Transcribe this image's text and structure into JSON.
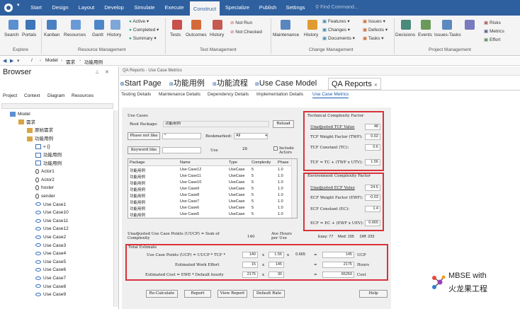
{
  "menubar": {
    "app_icon": "ea-icon",
    "tabs": [
      "Start",
      "Design",
      "Layout",
      "Develop",
      "Simulate",
      "Execute",
      "Construct",
      "Specialize",
      "Publish",
      "Settings"
    ],
    "active_tab": "Construct",
    "find_placeholder": "Find Command..."
  },
  "ribbon": {
    "explore": {
      "group": "Explore",
      "search": "Search",
      "portals": "Portals"
    },
    "resource": {
      "group": "Resource Management",
      "kanban": "Kanban",
      "resources": "Resources",
      "gantt": "Gantt",
      "history": "History",
      "active": "Active",
      "completed": "Completed",
      "summary": "Summary"
    },
    "test": {
      "group": "Test Management",
      "tests": "Tests",
      "outcomes": "Outcomes",
      "history": "History",
      "not_run": "Not Run",
      "not_checked": "Not Checked"
    },
    "change": {
      "group": "Change Management",
      "maintenance": "Maintenance",
      "history": "History",
      "features": "Features",
      "changes": "Changes",
      "documents": "Documents",
      "issues": "Issues",
      "defects": "Defects",
      "tasks": "Tasks"
    },
    "project": {
      "group": "Project Management",
      "decisions": "Decisions",
      "events": "Events",
      "issues_tasks": "Issues-Tasks",
      "risks": "Risks",
      "metrics": "Metrics",
      "effort": "Effort"
    }
  },
  "address": {
    "path": [
      "/",
      "Model",
      "需求",
      "功能用例"
    ]
  },
  "browser": {
    "title": "Browser",
    "tabs": [
      "Project",
      "Context",
      "Diagram",
      "Resources"
    ],
    "tree": [
      {
        "label": "Model",
        "indent": 0
      },
      {
        "label": "需求",
        "indent": 1
      },
      {
        "label": "原始需求",
        "indent": 2
      },
      {
        "label": "功能用例",
        "indent": 2
      },
      {
        "label": "«  {}",
        "indent": 3
      },
      {
        "label": "功能用例",
        "indent": 3
      },
      {
        "label": "功能用例",
        "indent": 3
      },
      {
        "label": "Actor1",
        "indent": 3
      },
      {
        "label": "Actor2",
        "indent": 3
      },
      {
        "label": "hoster",
        "indent": 3
      },
      {
        "label": "sender",
        "indent": 3
      },
      {
        "label": "Use Case1",
        "indent": 3
      },
      {
        "label": "Use Case10",
        "indent": 3
      },
      {
        "label": "Use Case11",
        "indent": 3
      },
      {
        "label": "Use Case12",
        "indent": 3
      },
      {
        "label": "Use Case2",
        "indent": 3
      },
      {
        "label": "Use Case3",
        "indent": 3
      },
      {
        "label": "Use Case4",
        "indent": 3
      },
      {
        "label": "Use Case5",
        "indent": 3
      },
      {
        "label": "Use Case6",
        "indent": 3
      },
      {
        "label": "Use Case7",
        "indent": 3
      },
      {
        "label": "Use Case8",
        "indent": 3
      },
      {
        "label": "Use Case9",
        "indent": 3
      }
    ]
  },
  "main": {
    "crumb": "QA Reports - Use Case Metrics",
    "doc_tabs": [
      "Start Page",
      "功能用例",
      "功能流程",
      "Use Case Model",
      "QA Reports"
    ],
    "active_doc_tab": "QA Reports",
    "sub_tabs": [
      "Testing Details",
      "Maintenance Details",
      "Dependency Details",
      "Implementation Details",
      "Use Case Metrics"
    ],
    "active_sub_tab": "Use Case Metrics"
  },
  "form": {
    "use_cases_label": "Use Cases",
    "root_package_label": "Root Package:",
    "root_package_value": "功能用例",
    "reload": "Reload",
    "phase_label": "Phase not like",
    "phase_value": "*",
    "bookmarked_label": "Bookmarked:",
    "bookmarked_value": "All",
    "keyword_label": "Keyword like",
    "use_label": "Use",
    "use_count": "28",
    "include_actors": "Include Actors",
    "table": {
      "headers": [
        "Package",
        "Name",
        "Type",
        "Complexity",
        "Phase"
      ],
      "rows": [
        [
          "功能用例",
          "Use Case12",
          "UseCase",
          "5",
          "1.0"
        ],
        [
          "功能用例",
          "Use Case11",
          "UseCase",
          "5",
          "1.0"
        ],
        [
          "功能用例",
          "Use Case10",
          "UseCase",
          "5",
          "1.0"
        ],
        [
          "功能用例",
          "Use Case9",
          "UseCase",
          "5",
          "1.0"
        ],
        [
          "功能用例",
          "Use Case8",
          "UseCase",
          "5",
          "1.0"
        ],
        [
          "功能用例",
          "Use Case7",
          "UseCase",
          "5",
          "1.0"
        ],
        [
          "功能用例",
          "Use Case6",
          "UseCase",
          "5",
          "1.0"
        ],
        [
          "功能用例",
          "Use Case5",
          "UseCase",
          "5",
          "1.0"
        ]
      ]
    },
    "uucp_label": "Unadjusted Use Case Points (UUCP) = Sum of Complexity",
    "uucp_value": "140",
    "ave_hours_label": "Ave Hours per Use",
    "easy": "Easy: 77",
    "med": "Med: 155",
    "diff": "Diff: 233",
    "tcf": {
      "title": "Technical Complexity Factor",
      "unadjusted_label": "Unadjusted TCF Value",
      "unadjusted_value": "48",
      "weight_label": "TCF Weight Factor (TWF):",
      "weight_value": "0.02",
      "constant_label": "TCF Constant (TC):",
      "constant_value": "0.6",
      "formula_label": "TCF = TC + (TWF x UTV):",
      "formula_value": "1.56"
    },
    "ecf": {
      "title": "Environment Complexity Factor",
      "unadjusted_label": "Unadjusted ECF Value",
      "unadjusted_value": "24.5",
      "weight_label": "ECF Weight Factor (EWF):",
      "weight_value": "-0.03",
      "constant_label": "ECF Constant (EC):",
      "constant_value": "1.4",
      "formula_label": "ECF  = EC + (EWF x UEV):",
      "formula_value": "0.665"
    },
    "total": {
      "title": "Total Estimate",
      "ucp_label": "Use Case Points (UCP) = UUCP * TCF *",
      "ucp_values": [
        "140",
        "1.56",
        "0.665"
      ],
      "ucp_result": "145",
      "ucp_unit": "UCP",
      "effort_label": "Estimated Work Effort",
      "effort_values": [
        "15",
        "145"
      ],
      "effort_result": "2175",
      "effort_unit": "Hours",
      "cost_label": "Estimated Cost  = EWE * Default hourly",
      "cost_values": [
        "2175",
        "30"
      ],
      "cost_result": "65250",
      "cost_unit": "Cost",
      "ops": [
        "x",
        "x",
        "=",
        "x",
        "=",
        "x",
        "="
      ]
    },
    "buttons": {
      "recalc": "Re-Calculate",
      "report": "Report",
      "view_report": "View Report",
      "default_rate": "Default Rate",
      "help": "Help"
    }
  },
  "watermark": {
    "line1": "MBSE with",
    "line2": "火龙果工程"
  }
}
